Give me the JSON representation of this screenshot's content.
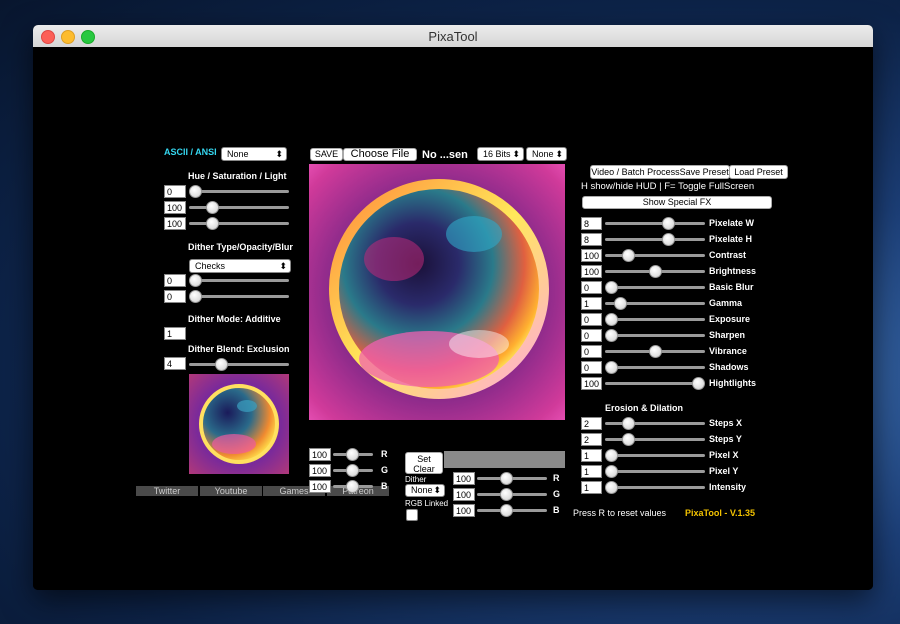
{
  "window": {
    "title": "PixaTool"
  },
  "left": {
    "ascii_label": "ASCII / ANSI",
    "ascii_select": "None",
    "hsl_title": "Hue / Saturation / Light",
    "hsl": [
      {
        "value": "0",
        "level": 0.0
      },
      {
        "value": "100",
        "level": 0.2
      },
      {
        "value": "100",
        "level": 0.2
      }
    ],
    "dither_title": "Dither Type/Opacity/Blur",
    "dither_select": "Checks",
    "dither": [
      {
        "value": "0",
        "level": 0.0
      },
      {
        "value": "0",
        "level": 0.0
      }
    ],
    "mode_title": "Dither Mode: Additive",
    "mode_value": "1",
    "blend_title": "Dither Blend: Exclusion",
    "blend_value": "4",
    "blend_level": 0.3
  },
  "links": [
    "Twitter",
    "Youtube",
    "Games",
    "Patreon"
  ],
  "center": {
    "save_label": "SAVE",
    "choose_file": "Choose File",
    "file_status": "No ...sen",
    "bits_select": "16 Bits",
    "none_select": "None",
    "rgb": [
      {
        "value": "100",
        "label": "R"
      },
      {
        "value": "100",
        "label": "G"
      },
      {
        "value": "100",
        "label": "B"
      }
    ],
    "set_label": "Set",
    "clear_label": "Clear",
    "dither_label": "Dither",
    "dither_select": "None",
    "rgb_linked_label": "RGB Linked",
    "rgb2": [
      {
        "value": "100",
        "label": "R"
      },
      {
        "value": "100",
        "label": "G"
      },
      {
        "value": "100",
        "label": "B"
      }
    ]
  },
  "right": {
    "video_button": "Video / Batch Process",
    "save_preset": "Save Preset",
    "load_preset": "Load Preset",
    "hud_hint": "H show/hide HUD  |  F= Toggle FullScreen",
    "special_fx": "Show Special FX",
    "sliders": [
      {
        "value": "8",
        "label": "Pixelate W",
        "level": 0.65
      },
      {
        "value": "8",
        "label": "Pixelate H",
        "level": 0.65
      },
      {
        "value": "100",
        "label": "Contrast",
        "level": 0.2
      },
      {
        "value": "100",
        "label": "Brightness",
        "level": 0.5
      },
      {
        "value": "0",
        "label": "Basic Blur",
        "level": 0.0
      },
      {
        "value": "1",
        "label": "Gamma",
        "level": 0.1
      },
      {
        "value": "0",
        "label": "Exposure",
        "level": 0.0
      },
      {
        "value": "0",
        "label": "Sharpen",
        "level": 0.0
      },
      {
        "value": "0",
        "label": "Vibrance",
        "level": 0.5
      },
      {
        "value": "0",
        "label": "Shadows",
        "level": 0.0
      },
      {
        "value": "100",
        "label": "Hightlights",
        "level": 1.0
      }
    ],
    "erosion_title": "Erosion & Dilation",
    "erosion": [
      {
        "value": "2",
        "label": "Steps X",
        "level": 0.2
      },
      {
        "value": "2",
        "label": "Steps Y",
        "level": 0.2
      },
      {
        "value": "1",
        "label": "Pixel X",
        "level": 0.0
      },
      {
        "value": "1",
        "label": "Pixel Y",
        "level": 0.0
      },
      {
        "value": "1",
        "label": "Intensity",
        "level": 0.0
      }
    ],
    "reset_hint": "Press R to reset values",
    "version": "PixaTool - V.1.35",
    "version_color": "#f2c200"
  }
}
